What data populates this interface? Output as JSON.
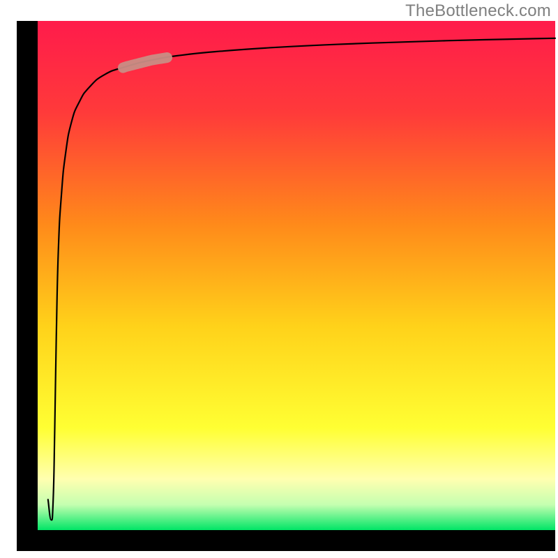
{
  "attribution": "TheBottleneck.com",
  "chart_data": {
    "type": "line",
    "title": "",
    "xlabel": "",
    "ylabel": "",
    "xlim": [
      0,
      100
    ],
    "ylim": [
      0,
      100
    ],
    "axes_visible": false,
    "background_gradient": {
      "stops": [
        {
          "offset": 0.0,
          "color": "#ff1b4b"
        },
        {
          "offset": 0.18,
          "color": "#ff3a3a"
        },
        {
          "offset": 0.4,
          "color": "#ff8a1a"
        },
        {
          "offset": 0.6,
          "color": "#ffd21a"
        },
        {
          "offset": 0.8,
          "color": "#ffff33"
        },
        {
          "offset": 0.9,
          "color": "#ffffb0"
        },
        {
          "offset": 0.95,
          "color": "#c5ffb0"
        },
        {
          "offset": 1.0,
          "color": "#00e566"
        }
      ]
    },
    "plot_frame": {
      "stroke": "#000000",
      "stroke_width": 7,
      "sides": [
        "left",
        "bottom"
      ]
    },
    "series": [
      {
        "name": "bottleneck-curve",
        "stroke": "#000000",
        "stroke_width": 2.2,
        "x": [
          2.0,
          2.6,
          3.0,
          3.3,
          3.6,
          4.0,
          4.6,
          5.4,
          6.5,
          8.0,
          10.0,
          13.0,
          17.0,
          22.0,
          28.0,
          36.0,
          46.0,
          58.0,
          72.0,
          86.0,
          100.0
        ],
        "y": [
          6.0,
          2.0,
          6.0,
          20.0,
          38.0,
          55.0,
          66.0,
          74.0,
          80.0,
          84.0,
          87.0,
          89.5,
          91.0,
          92.3,
          93.3,
          94.1,
          94.8,
          95.4,
          95.9,
          96.3,
          96.6
        ]
      }
    ],
    "highlight_segment": {
      "series": "bottleneck-curve",
      "x_range": [
        16.5,
        25.0
      ],
      "stroke": "#c98d85",
      "stroke_width": 15,
      "linecap": "round"
    }
  }
}
